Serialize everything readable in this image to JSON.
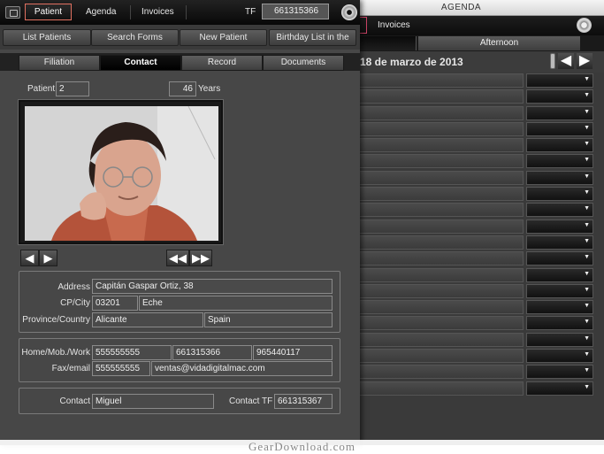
{
  "agenda": {
    "window_title": "AGENDA",
    "toolbar_invoices": "Invoices",
    "shift_tab": "Afternoon",
    "date": "18 de marzo de 2013",
    "row_count": 20
  },
  "patient_window": {
    "toolbar": {
      "patient_tab": "Patient",
      "agenda_tab": "Agenda",
      "invoices_tab": "Invoices",
      "tf_label": "TF",
      "tf_value": "661315366"
    },
    "nav_buttons": [
      "List Patients",
      "Search Forms",
      "New Patient",
      "Birthday List in the"
    ],
    "sub_tabs": [
      "Filiation",
      "Contact",
      "Record",
      "Documents"
    ],
    "active_sub_tab": "Contact",
    "patient_label": "Patient",
    "patient_number": "2",
    "age": "46",
    "age_unit": "Years",
    "address": {
      "address_label": "Address",
      "address_value": "Capitán Gaspar Ortiz, 38",
      "cp_city_label": "CP/City",
      "cp": "03201",
      "city": "Eche",
      "province_country_label": "Province/Country",
      "province": "Alicante",
      "country": "Spain"
    },
    "phones": {
      "home_mob_work_label": "Home/Mob./Work",
      "home": "555555555",
      "mobile": "661315366",
      "work": "965440117",
      "fax_email_label": "Fax/email",
      "fax": "555555555",
      "email": "ventas@vidadigitalmac.com"
    },
    "contact": {
      "contact_label": "Contact",
      "contact_value": "Miguel",
      "contact_tf_label": "Contact TF",
      "contact_tf_value": "661315367"
    }
  },
  "watermark": "GearDownload.com",
  "colors": {
    "window_bg": "#474747",
    "toolbar_bg": "#111111",
    "active_tab_border": "#e07060",
    "field_bg": "#4a4a4a"
  }
}
